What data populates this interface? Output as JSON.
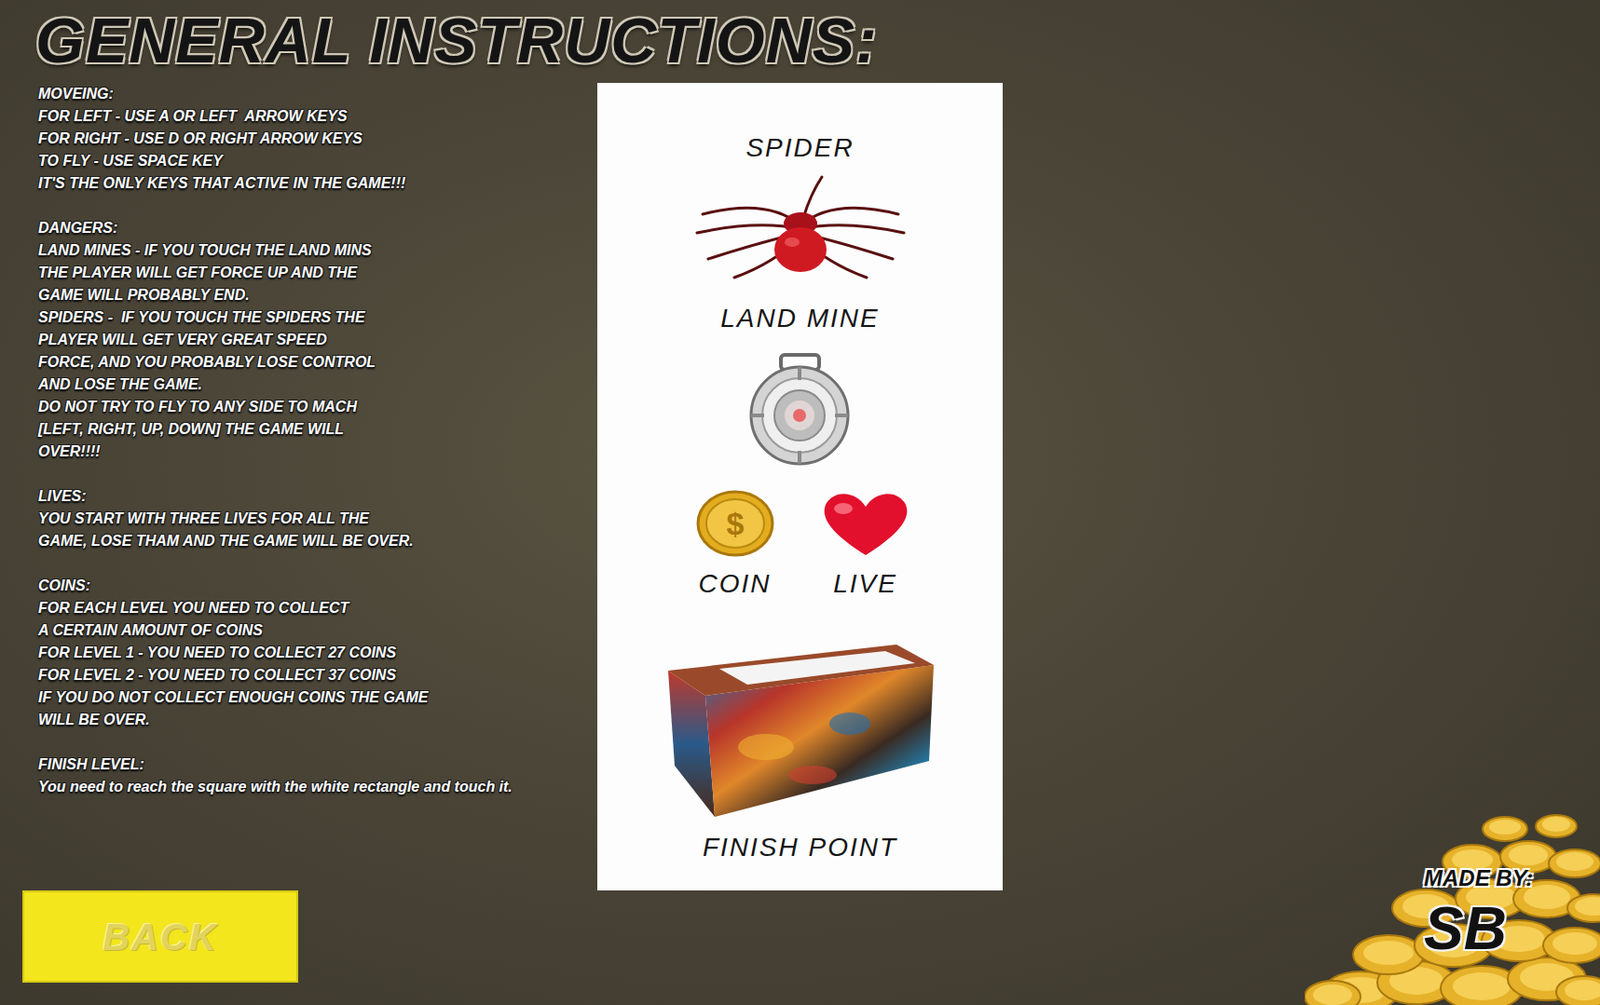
{
  "title": "GENERAL INSTRUCTIONS:",
  "sections": [
    {
      "heading": "MOVEING:",
      "lines": [
        "FOR LEFT - USE A OR LEFT  ARROW KEYS",
        "FOR RIGHT - USE D OR RIGHT ARROW KEYS",
        "TO FLY - USE SPACE KEY",
        "IT'S THE ONLY KEYS THAT ACTIVE IN THE GAME!!!"
      ]
    },
    {
      "heading": "DANGERS:",
      "lines": [
        "LAND MINES - IF YOU TOUCH THE LAND MINS",
        "THE PLAYER WILL GET FORCE UP AND THE",
        "GAME WILL PROBABLY END.",
        "SPIDERS -  IF YOU TOUCH THE SPIDERS THE",
        "PLAYER WILL GET VERY GREAT SPEED",
        "FORCE, AND YOU PROBABLY LOSE CONTROL",
        "AND LOSE THE GAME.",
        "DO NOT TRY TO FLY TO ANY SIDE TO MACH",
        "[LEFT, RIGHT, UP, DOWN] THE GAME WILL",
        "OVER!!!!"
      ]
    },
    {
      "heading": "LIVES:",
      "lines": [
        "YOU START WITH THREE LIVES FOR ALL THE",
        "GAME, LOSE THAM AND THE GAME WILL BE OVER."
      ]
    },
    {
      "heading": "COINS:",
      "lines": [
        "FOR EACH LEVEL YOU NEED TO COLLECT",
        "A CERTAIN AMOUNT OF COINS",
        "FOR LEVEL 1 - YOU NEED TO COLLECT 27 COINS",
        "FOR LEVEL 2 - YOU NEED TO COLLECT 37 COINS",
        "IF YOU DO NOT COLLECT ENOUGH COINS THE GAME",
        "WILL BE OVER."
      ]
    },
    {
      "heading": "FINISH LEVEL:",
      "lines": [
        "You need to reach the square with the white rectangle and touch it."
      ]
    }
  ],
  "legend": [
    {
      "items": [
        {
          "label": "SPIDER",
          "kind": "spider"
        }
      ]
    },
    {
      "items": [
        {
          "label": "LAND MINE",
          "kind": "mine"
        }
      ]
    },
    {
      "items": [
        {
          "label": "COIN",
          "kind": "coin",
          "symbol": "$"
        },
        {
          "label": "LIVE",
          "kind": "heart"
        }
      ]
    },
    {
      "items": [
        {
          "label": "FINISH POINT",
          "kind": "finish"
        }
      ]
    }
  ],
  "back_button": {
    "label": "BACK"
  },
  "credit": {
    "label": "MADE BY:",
    "signature": "SB"
  }
}
